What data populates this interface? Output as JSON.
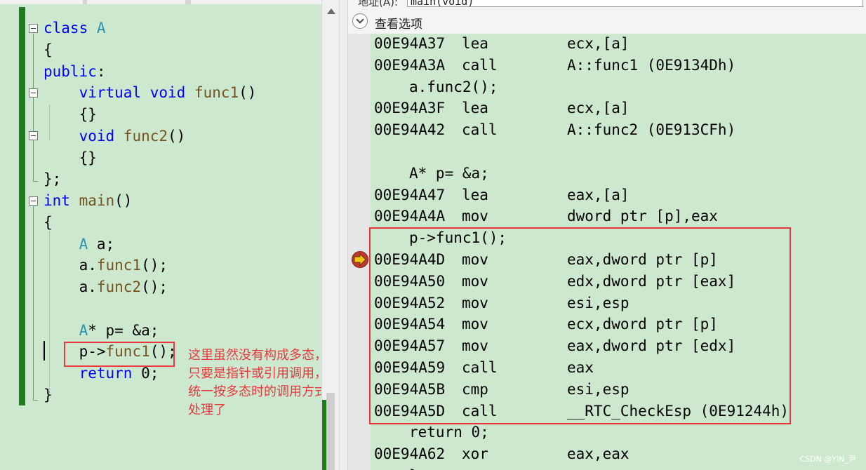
{
  "source": {
    "lines": [
      {
        "spans": [
          {
            "t": "class ",
            "c": "kw"
          },
          {
            "t": "A",
            "c": "ty"
          }
        ]
      },
      {
        "spans": [
          {
            "t": "{",
            "c": "tx"
          }
        ]
      },
      {
        "spans": [
          {
            "t": "public",
            "c": "kw"
          },
          {
            "t": ":",
            "c": "tx"
          }
        ]
      },
      {
        "spans": [
          {
            "t": "    virtual void ",
            "c": "kw"
          },
          {
            "t": "func1",
            "c": "fn"
          },
          {
            "t": "()",
            "c": "tx"
          }
        ]
      },
      {
        "spans": [
          {
            "t": "    {}",
            "c": "tx"
          }
        ]
      },
      {
        "spans": [
          {
            "t": "    void ",
            "c": "kw"
          },
          {
            "t": "func2",
            "c": "fn"
          },
          {
            "t": "()",
            "c": "tx"
          }
        ]
      },
      {
        "spans": [
          {
            "t": "    {}",
            "c": "tx"
          }
        ]
      },
      {
        "spans": [
          {
            "t": "};",
            "c": "tx"
          }
        ]
      },
      {
        "spans": [
          {
            "t": "int ",
            "c": "kw"
          },
          {
            "t": "main",
            "c": "fn"
          },
          {
            "t": "()",
            "c": "tx"
          }
        ]
      },
      {
        "spans": [
          {
            "t": "{",
            "c": "tx"
          }
        ]
      },
      {
        "spans": [
          {
            "t": "    ",
            "c": "tx"
          },
          {
            "t": "A",
            "c": "ty"
          },
          {
            "t": " a;",
            "c": "tx"
          }
        ]
      },
      {
        "spans": [
          {
            "t": "    a.",
            "c": "tx"
          },
          {
            "t": "func1",
            "c": "fn"
          },
          {
            "t": "();",
            "c": "tx"
          }
        ]
      },
      {
        "spans": [
          {
            "t": "    a.",
            "c": "tx"
          },
          {
            "t": "func2",
            "c": "fn"
          },
          {
            "t": "();",
            "c": "tx"
          }
        ]
      },
      {
        "spans": [
          {
            "t": "",
            "c": "tx"
          }
        ]
      },
      {
        "spans": [
          {
            "t": "    ",
            "c": "tx"
          },
          {
            "t": "A",
            "c": "ty"
          },
          {
            "t": "* p= &a;",
            "c": "tx"
          }
        ]
      },
      {
        "spans": [
          {
            "t": "    p->",
            "c": "tx"
          },
          {
            "t": "func1",
            "c": "fn"
          },
          {
            "t": "();",
            "c": "tx"
          }
        ]
      },
      {
        "spans": [
          {
            "t": "    ",
            "c": "tx"
          },
          {
            "t": "return",
            "c": "kw"
          },
          {
            "t": " 0;",
            "c": "tx"
          }
        ]
      },
      {
        "spans": [
          {
            "t": "}",
            "c": "tx"
          }
        ]
      }
    ]
  },
  "annotation": {
    "lines": [
      "这里虽然没有构成多态，但",
      "只要是指针或引用调用，",
      "统一按多态时的调用方式",
      "处理了"
    ]
  },
  "address_bar": {
    "label": "地址(A):",
    "value": "main(void)"
  },
  "view_options": {
    "label": "查看选项"
  },
  "disassembly": [
    {
      "kind": "asm",
      "addr": "00E94A37",
      "mn": "lea",
      "ops": "ecx,[a]"
    },
    {
      "kind": "asm",
      "addr": "00E94A3A",
      "mn": "call",
      "ops": "A::func1 (0E9134Dh)"
    },
    {
      "kind": "src",
      "text": "a.func2();"
    },
    {
      "kind": "asm",
      "addr": "00E94A3F",
      "mn": "lea",
      "ops": "ecx,[a]"
    },
    {
      "kind": "asm",
      "addr": "00E94A42",
      "mn": "call",
      "ops": "A::func2 (0E913CFh)"
    },
    {
      "kind": "src",
      "text": ""
    },
    {
      "kind": "src",
      "text": "A* p= &a;"
    },
    {
      "kind": "asm",
      "addr": "00E94A47",
      "mn": "lea",
      "ops": "eax,[a]"
    },
    {
      "kind": "asm",
      "addr": "00E94A4A",
      "mn": "mov",
      "ops": "dword ptr [p],eax"
    },
    {
      "kind": "src",
      "text": "p->func1();"
    },
    {
      "kind": "asm",
      "addr": "00E94A4D",
      "mn": "mov",
      "ops": "eax,dword ptr [p]"
    },
    {
      "kind": "asm",
      "addr": "00E94A50",
      "mn": "mov",
      "ops": "edx,dword ptr [eax]"
    },
    {
      "kind": "asm",
      "addr": "00E94A52",
      "mn": "mov",
      "ops": "esi,esp"
    },
    {
      "kind": "asm",
      "addr": "00E94A54",
      "mn": "mov",
      "ops": "ecx,dword ptr [p]"
    },
    {
      "kind": "asm",
      "addr": "00E94A57",
      "mn": "mov",
      "ops": "eax,dword ptr [edx]"
    },
    {
      "kind": "asm",
      "addr": "00E94A59",
      "mn": "call",
      "ops": "eax"
    },
    {
      "kind": "asm",
      "addr": "00E94A5B",
      "mn": "cmp",
      "ops": "esi,esp"
    },
    {
      "kind": "asm",
      "addr": "00E94A5D",
      "mn": "call",
      "ops": "__RTC_CheckEsp (0E91244h)"
    },
    {
      "kind": "src",
      "text": "return 0;"
    },
    {
      "kind": "asm",
      "addr": "00E94A62",
      "mn": "xor",
      "ops": "eax,eax"
    },
    {
      "kind": "src",
      "text": "}"
    }
  ],
  "current_instruction_index": 10,
  "watermark": "CSDN @YIN_尹",
  "colors": {
    "editor_bg": "#cce8cf",
    "keyword": "#0000ff",
    "type": "#2b91af",
    "function": "#74531f",
    "highlight_box": "#e8383d",
    "change_bar": "#1e7b1e"
  },
  "icons": [
    "chevron-down-icon",
    "instruction-pointer-arrow-icon",
    "fold-toggle-icon",
    "scroll-up-arrow-icon"
  ]
}
